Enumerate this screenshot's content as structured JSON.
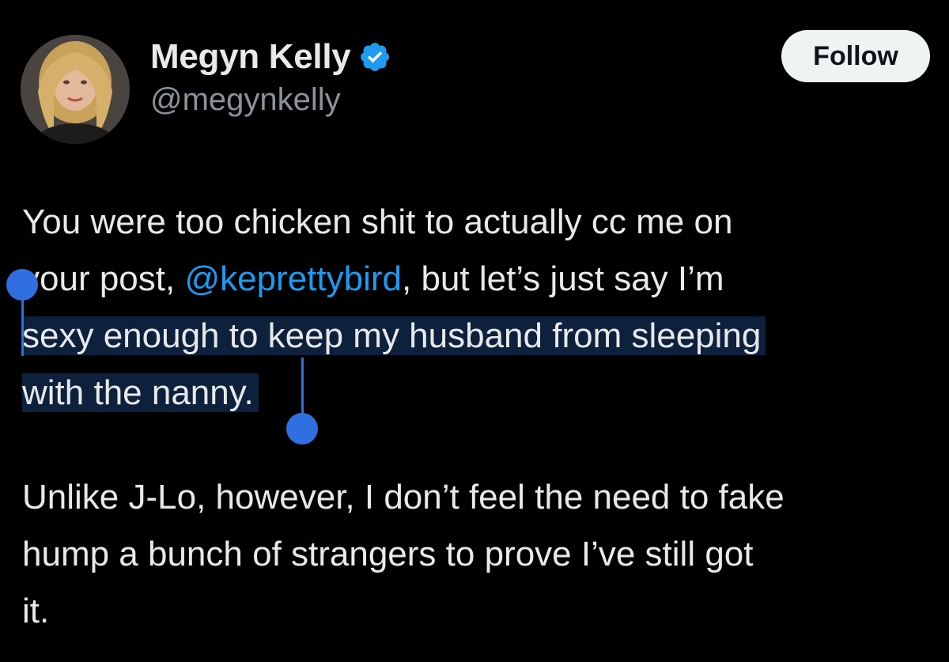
{
  "profile": {
    "display_name": "Megyn Kelly",
    "handle": "@megynkelly",
    "verified_icon": "verified-badge-icon",
    "avatar_icon": "profile-photo"
  },
  "actions": {
    "follow_label": "Follow"
  },
  "tweet": {
    "paragraph1": {
      "line1": "You were too chicken shit to actually cc me on",
      "line2_pre": "your post, ",
      "mention": "@keprettybird",
      "line2_post": ", but let’s just say I’m",
      "line3": "sexy enough to keep my husband from sleeping",
      "line4": "with the nanny."
    },
    "paragraph2": {
      "line1": "Unlike J-Lo, however, I don’t feel the need to fake",
      "line2": "hump a bunch of strangers to prove I’ve still got",
      "line3": "it."
    }
  },
  "colors": {
    "background": "#000000",
    "text": "#e7e9ea",
    "secondary_text": "#8b9298",
    "link": "#1d9bf0",
    "selection_highlight": "#0d213d",
    "selection_handle": "#2f6fe0",
    "verified_badge": "#1d9bf0",
    "follow_button_bg": "#eff3f4"
  }
}
